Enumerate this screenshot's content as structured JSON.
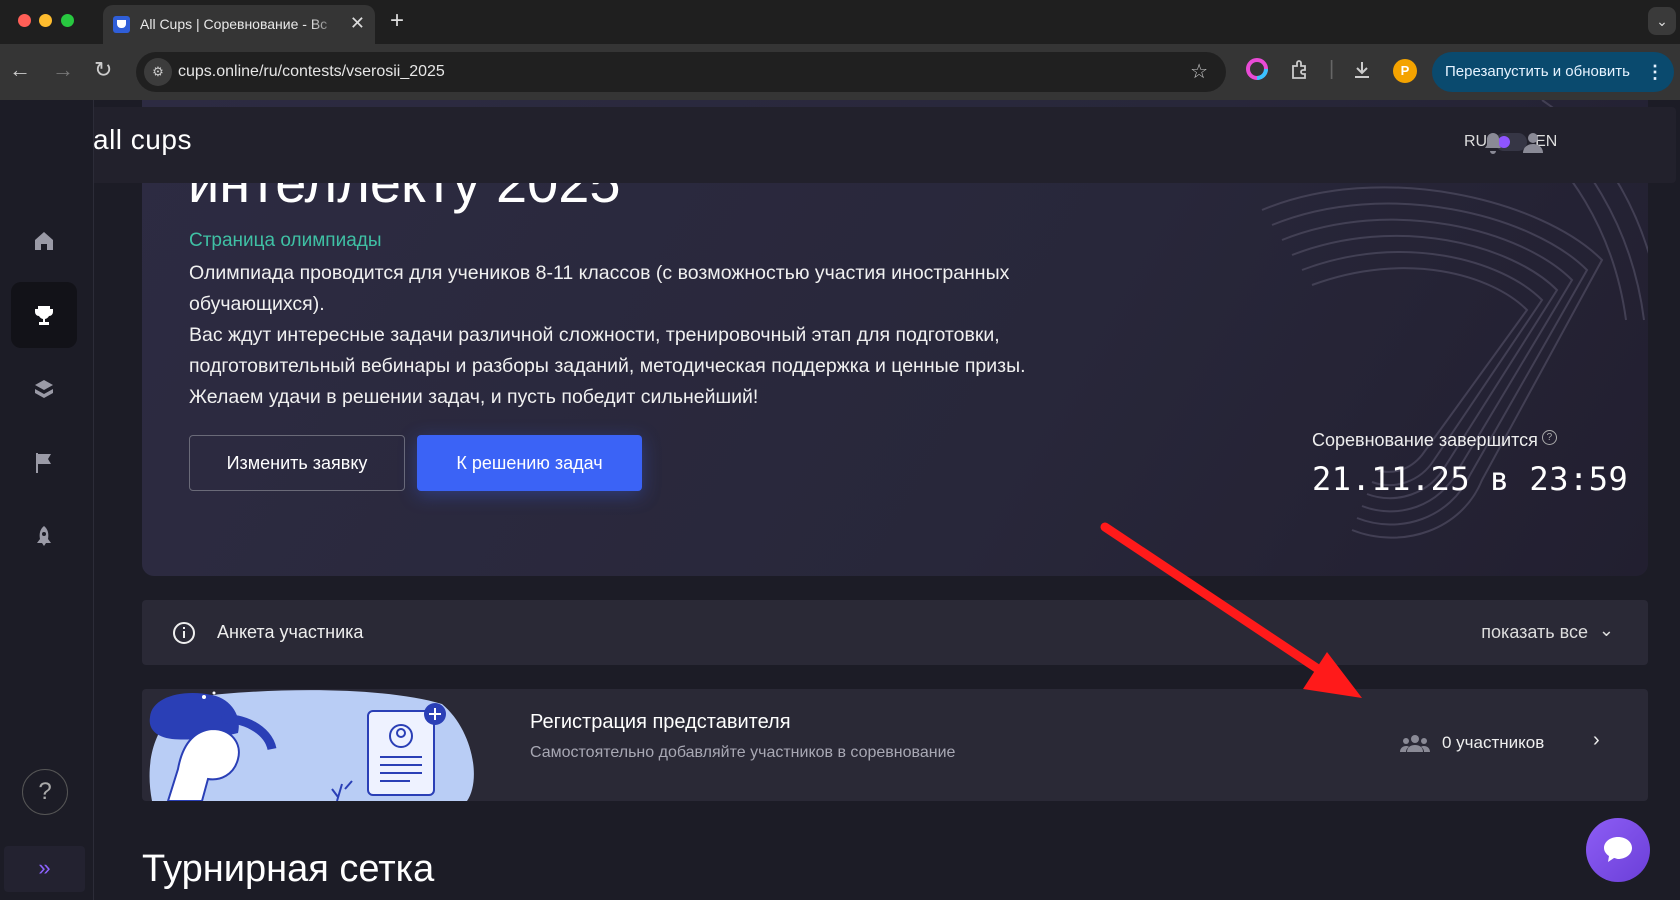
{
  "browser": {
    "tab_title": "All Cups | Соревнование - Вс",
    "url": "cups.online/ru/contests/vserosii_2025",
    "relaunch_label": "Перезапустить и обновить",
    "profile_initial": "P"
  },
  "header": {
    "brand": "all cups",
    "lang_ru": "RU",
    "lang_en": "EN"
  },
  "sidebar": {
    "items": [
      {
        "icon": "home-icon"
      },
      {
        "icon": "trophy-icon",
        "active": true
      },
      {
        "icon": "stack-icon"
      },
      {
        "icon": "flag-icon"
      },
      {
        "icon": "rocket-icon"
      }
    ],
    "help_label": "?",
    "expand_label": "»"
  },
  "hero": {
    "title": "интеллекту 2025",
    "link": "Страница олимпиады",
    "desc": [
      "Олимпиада проводится для учеников 8-11 классов (с возможностью участия иностранных обучающихся).",
      "Вас ждут интересные задачи различной сложности, тренировочный этап для подготовки, подготовительный вебинары и разборы заданий, методическая поддержка и ценные призы.",
      "Желаем удачи в решении задач, и пусть победит сильнейший!"
    ],
    "btn_edit": "Изменить заявку",
    "btn_solve": "К решению задач",
    "ends_label": "Соревнование завершится",
    "ends_date": "21.11.25 в 23:59"
  },
  "anketa": {
    "label": "Анкета участника",
    "show_all": "показать все"
  },
  "registration": {
    "title": "Регистрация представителя",
    "subtitle": "Самостоятельно добавляйте участников в соревнование",
    "count": "0 участников"
  },
  "bracket_title": "Турнирная сетка",
  "colors": {
    "accent_blue": "#3b63f6",
    "link_green": "#3fc0a4",
    "toggle_purple": "#8f55ff",
    "annotation_red": "#ff1a1a"
  }
}
